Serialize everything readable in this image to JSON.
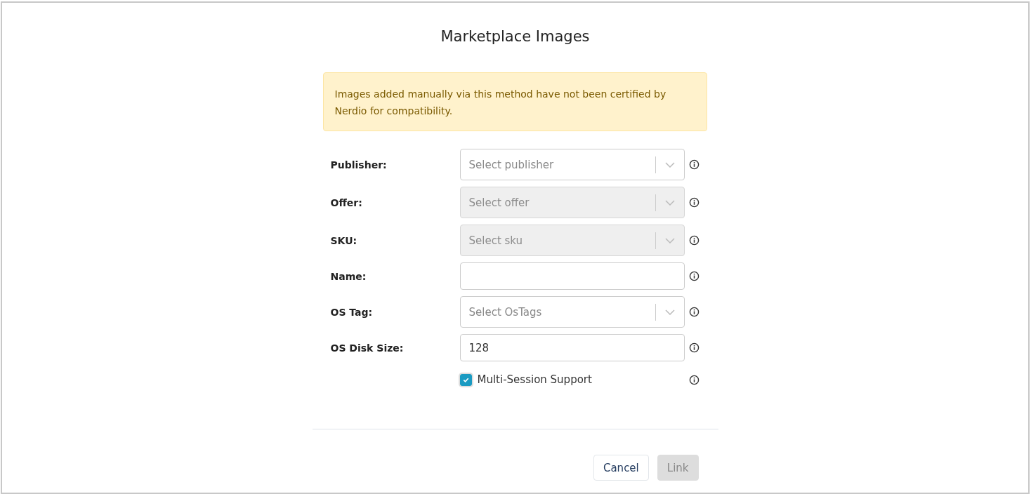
{
  "dialog": {
    "title": "Marketplace Images"
  },
  "warning": "Images added manually via this method have not been certified by Nerdio for compatibility.",
  "fields": [
    {
      "kind": "select",
      "label": "Publisher:",
      "placeholder": "Select publisher",
      "disabled": false
    },
    {
      "kind": "select",
      "label": "Offer:",
      "placeholder": "Select offer",
      "disabled": true
    },
    {
      "kind": "select",
      "label": "SKU:",
      "placeholder": "Select sku",
      "disabled": true
    },
    {
      "kind": "text",
      "label": "Name:"
    },
    {
      "kind": "select",
      "label": "OS Tag:",
      "placeholder": "Select OsTags",
      "disabled": false
    },
    {
      "kind": "text",
      "label": "OS Disk Size:",
      "value": "128"
    },
    {
      "kind": "checkbox",
      "label": "Multi-Session Support",
      "checked": true
    }
  ],
  "buttons": [
    {
      "label": "Cancel",
      "disabled": false
    },
    {
      "label": "Link",
      "disabled": true
    }
  ]
}
